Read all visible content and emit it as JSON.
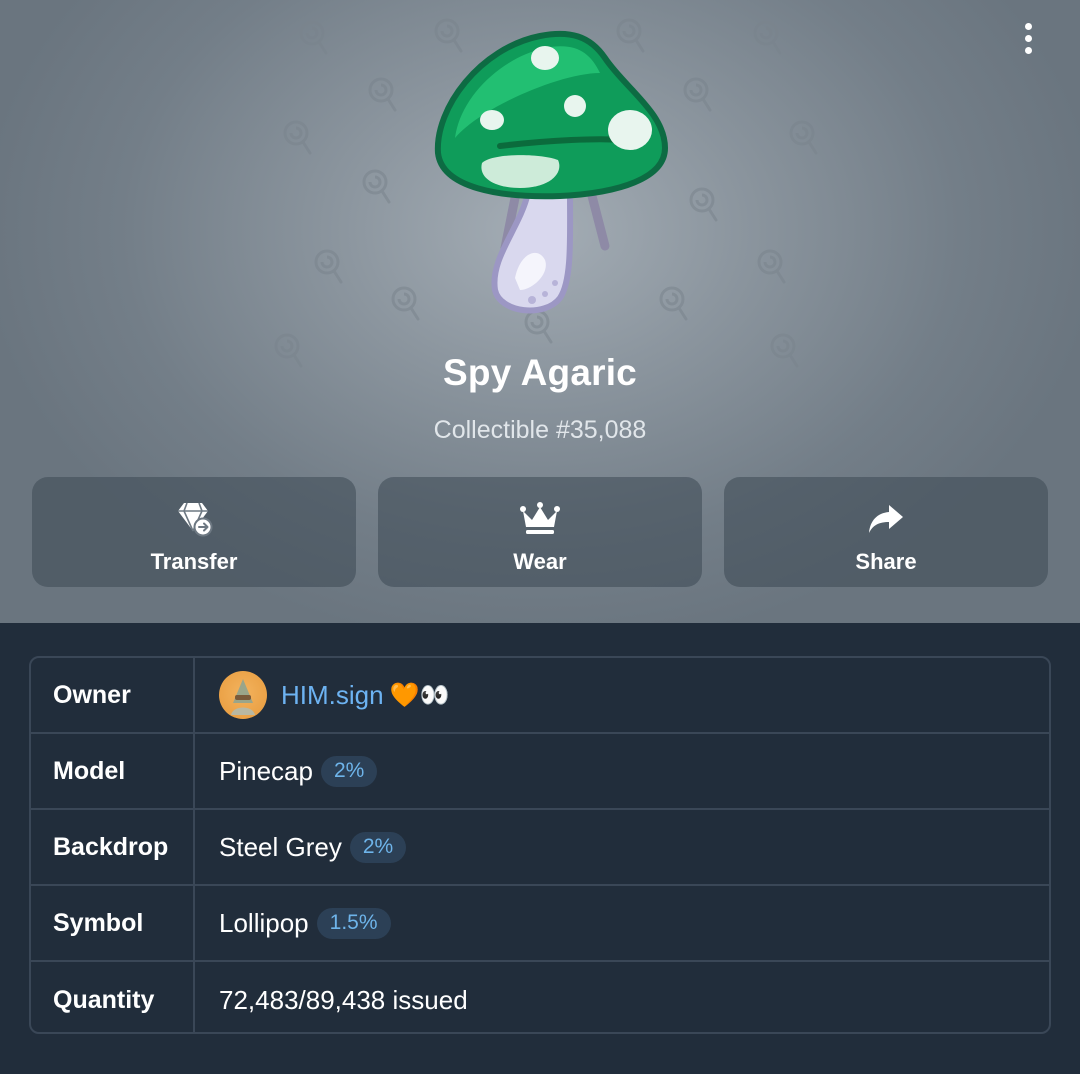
{
  "gift": {
    "title": "Spy Agaric",
    "subtitle": "Collectible #35,088"
  },
  "actions": [
    {
      "label": "Transfer",
      "icon": "diamond-transfer-icon"
    },
    {
      "label": "Wear",
      "icon": "crown-icon"
    },
    {
      "label": "Share",
      "icon": "share-arrow-icon"
    }
  ],
  "details": {
    "owner": {
      "label": "Owner",
      "name": "HIM.sign",
      "emoji": "🧡👀"
    },
    "model": {
      "label": "Model",
      "value": "Pinecap",
      "badge": "2%"
    },
    "backdrop": {
      "label": "Backdrop",
      "value": "Steel Grey",
      "badge": "2%"
    },
    "symbol": {
      "label": "Symbol",
      "value": "Lollipop",
      "badge": "1.5%"
    },
    "quantity": {
      "label": "Quantity",
      "value": "72,483/89,438 issued"
    }
  },
  "colors": {
    "backdrop": "#8c969f",
    "panel": "#212d3b",
    "link": "#6db3f2",
    "badge_text": "#6eb4ea"
  }
}
